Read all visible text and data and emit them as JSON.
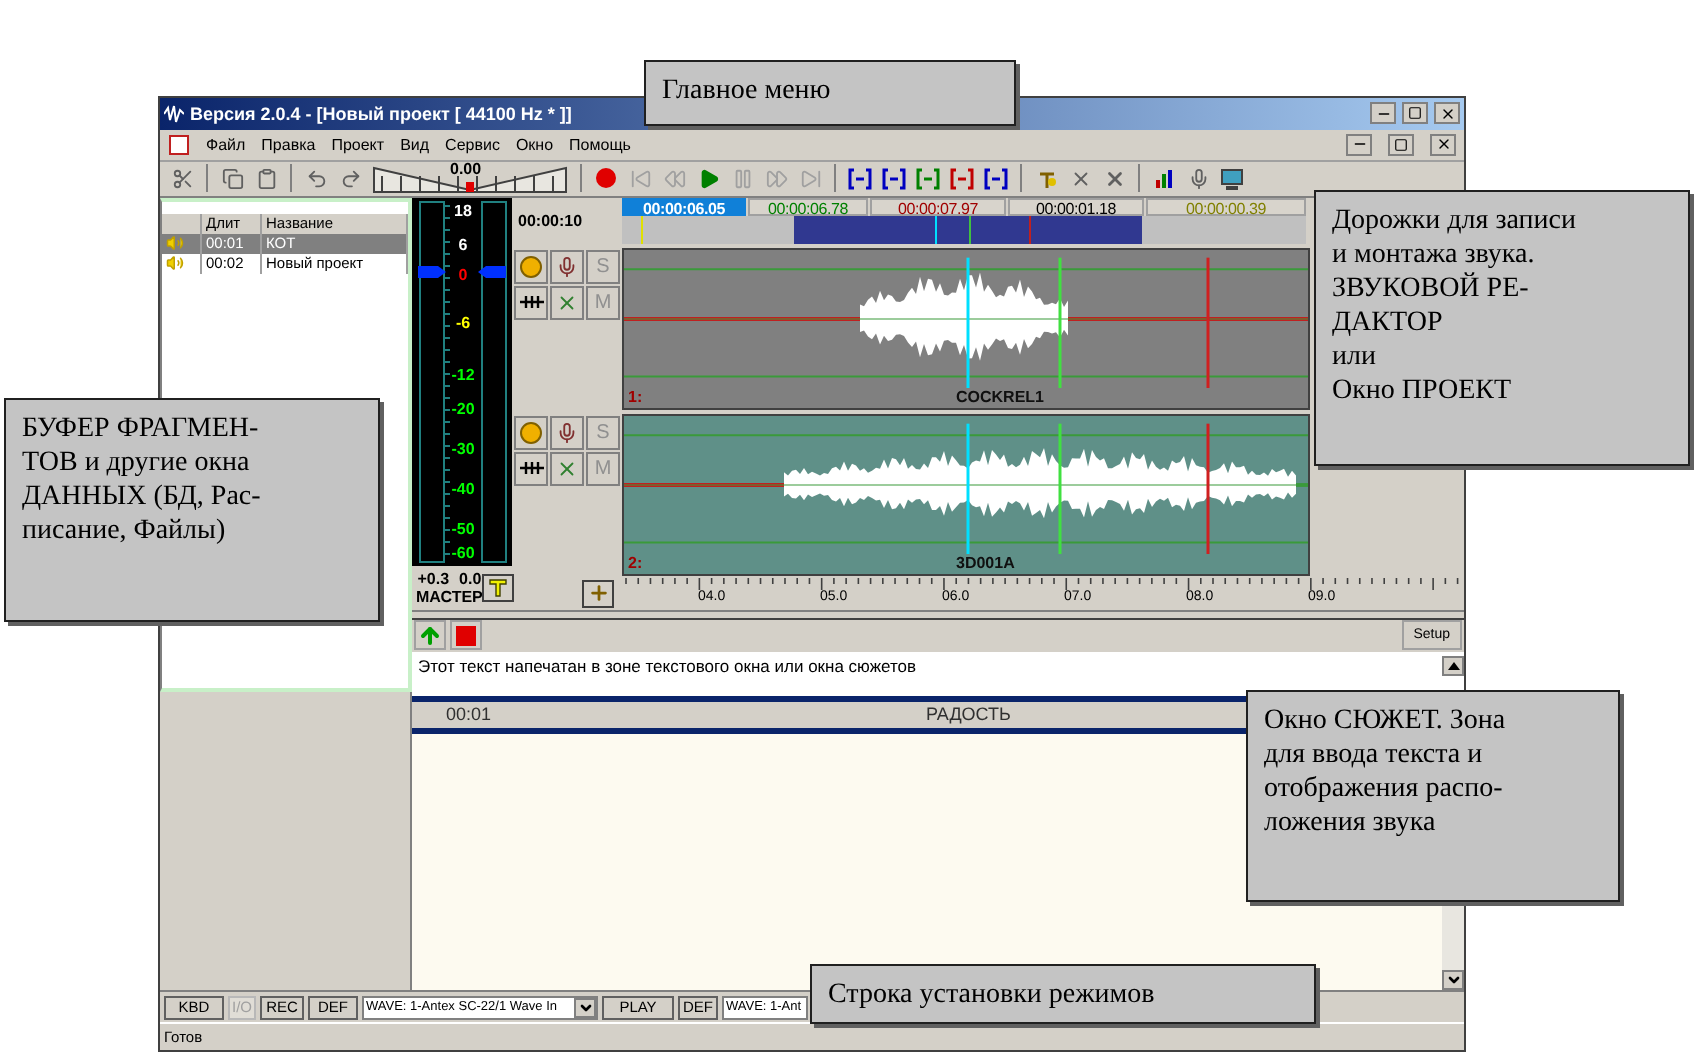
{
  "window": {
    "title": "Версия 2.0.4 - [Новый проект [ 44100 Hz * ]]"
  },
  "menu": [
    "Файл",
    "Правка",
    "Проект",
    "Вид",
    "Сервис",
    "Окно",
    "Помощь"
  ],
  "toolbar": {
    "level_reading": "0.00"
  },
  "fragments": {
    "columns": [
      "Длит",
      "Название"
    ],
    "rows": [
      {
        "duration": "00:01",
        "name": "КОТ",
        "selected": true
      },
      {
        "duration": "00:02",
        "name": "Новый проект",
        "selected": false
      }
    ]
  },
  "meter": {
    "scale": [
      {
        "label": "18",
        "color": "#ffffff"
      },
      {
        "label": "6",
        "color": "#ffffff"
      },
      {
        "label": "0",
        "color": "#ff0000"
      },
      {
        "label": "-6",
        "color": "#ffff00"
      },
      {
        "label": "-12",
        "color": "#00ff00"
      },
      {
        "label": "-20",
        "color": "#00ff00"
      },
      {
        "label": "-30",
        "color": "#00ff00"
      },
      {
        "label": "-40",
        "color": "#00ff00"
      },
      {
        "label": "-50",
        "color": "#00ff00"
      },
      {
        "label": "-60",
        "color": "#00ff00"
      }
    ],
    "readings": [
      "+0.3",
      "0.0"
    ],
    "label": "МАСТЕР"
  },
  "timeline": {
    "position": "00:00:10",
    "markers": [
      {
        "time": "00:00:06.05",
        "selected": true
      },
      {
        "time": "00:00:06.78",
        "color": "#008000",
        "selected": false
      },
      {
        "time": "00:00:07.97",
        "color": "#a00000",
        "selected": false
      },
      {
        "time": "00:00:01.18",
        "color": "#000000",
        "selected": false
      },
      {
        "time": "00:00:00.39",
        "color": "#808000",
        "selected": false
      }
    ]
  },
  "tracks": [
    {
      "number": "1:",
      "name": "COCKREL1",
      "kind": "short",
      "solo": "S",
      "mute": "M"
    },
    {
      "number": "2:",
      "name": "3D001A",
      "kind": "long",
      "solo": "S",
      "mute": "M"
    }
  ],
  "ruler": [
    "04.0",
    "05.0",
    "06.0",
    "07.0",
    "08.0",
    "09.0"
  ],
  "story": {
    "setup": "Setup",
    "text": "Этот текст напечатан в зоне текстового окна или окна сюжетов",
    "time": "00:01",
    "title": "РАДОСТЬ"
  },
  "mode_bar": [
    {
      "kind": "button",
      "label": "KBD",
      "disabled": false
    },
    {
      "kind": "button",
      "label": "I/O",
      "disabled": true
    },
    {
      "kind": "button",
      "label": "REC",
      "disabled": false
    },
    {
      "kind": "button",
      "label": "DEF",
      "disabled": false
    },
    {
      "kind": "select",
      "label": "WAVE: 1-Antex SC-22/1 Wave In"
    },
    {
      "kind": "button",
      "label": "PLAY",
      "disabled": false
    },
    {
      "kind": "button",
      "label": "DEF",
      "disabled": false
    },
    {
      "kind": "select-clipped",
      "label": "WAVE: 1-Ant"
    }
  ],
  "status": "Готов",
  "callouts": [
    {
      "text": "Главное меню"
    },
    {
      "text": "Дорожки для записи\nи монтажа звука.\nЗВУКОВОЙ РЕ-\nДАКТОР\nили\nОкно ПРОЕКТ"
    },
    {
      "text": "БУФЕР ФРАГМЕН-\nТОВ и другие окна\nДАННЫХ (БД, Рас-\nписание, Файлы)"
    },
    {
      "text": "Окно СЮЖЕТ. Зона\nдля ввода текста и\nотображения распо-\nложения звука"
    },
    {
      "text": "Строка установки режимов"
    }
  ]
}
